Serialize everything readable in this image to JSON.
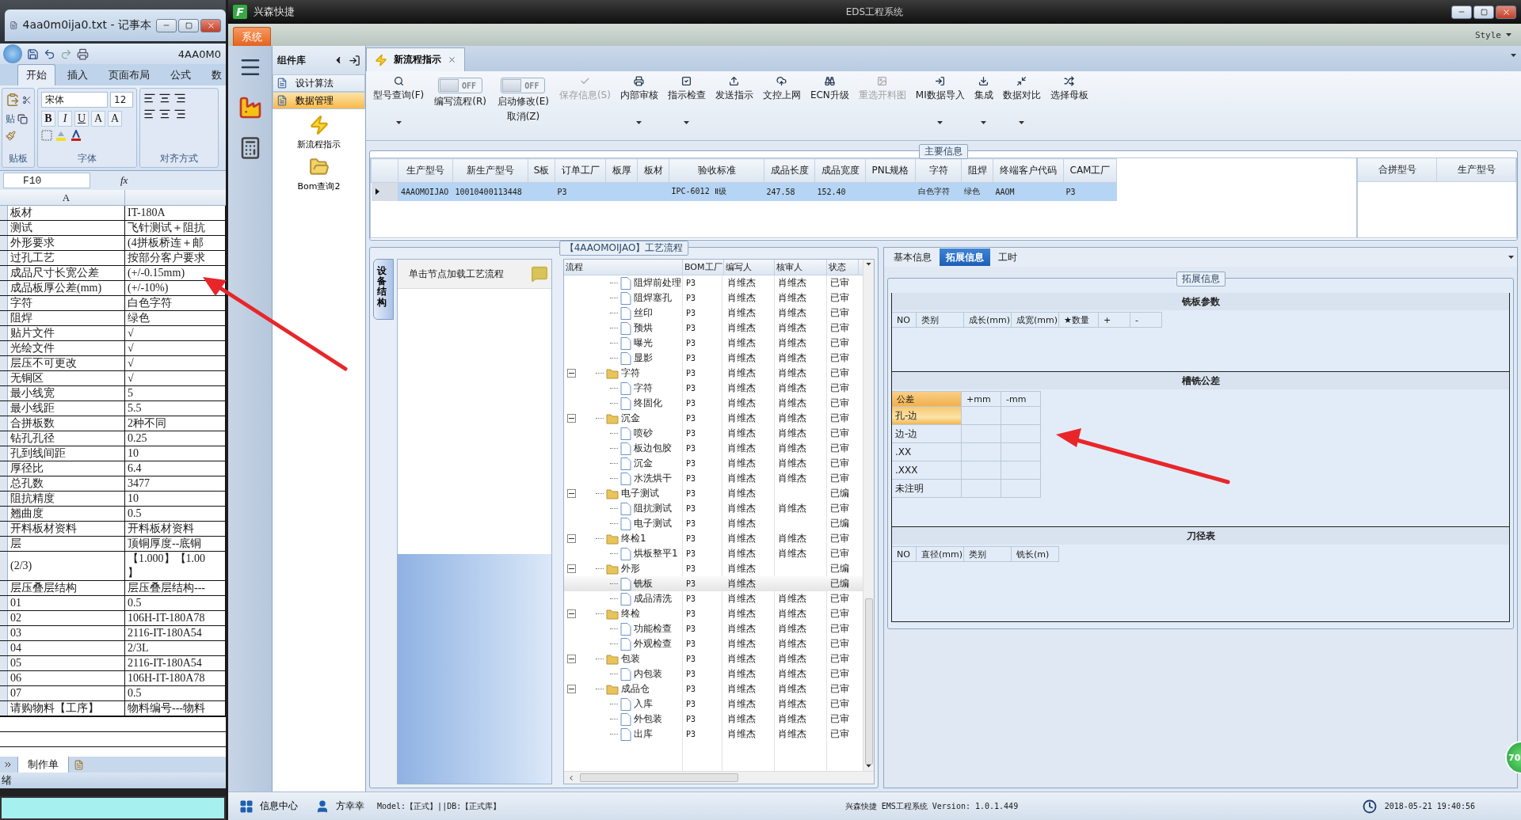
{
  "excel": {
    "notepad_title": "4aa0m0ija0.txt - 记事本",
    "book_title": "4AA0M0",
    "ribbon_tabs": [
      {
        "label": "开始",
        "selected": true
      },
      {
        "label": "插入",
        "selected": false
      },
      {
        "label": "页面布局",
        "selected": false
      },
      {
        "label": "公式",
        "selected": false
      },
      {
        "label": "数",
        "selected": false
      }
    ],
    "paste_label": "贴",
    "font_name": "宋体",
    "font_size": "12",
    "format_keys": [
      "B",
      "I",
      "U",
      "A",
      "A"
    ],
    "groups": [
      "贴板",
      "字体",
      "对齐方式"
    ],
    "name_box": "F10",
    "fx": "fx",
    "column_header": "A",
    "rows": [
      {
        "label": "板材",
        "value": "IT-180A"
      },
      {
        "label": "测试",
        "value": "飞针测试＋阻抗"
      },
      {
        "label": "外形要求",
        "value": "(4拼板桥连＋邮"
      },
      {
        "label": "过孔工艺",
        "value": "按部分客户要求"
      },
      {
        "label": "成品尺寸长宽公差",
        "value": "(+/-0.15mm)"
      },
      {
        "label": "成品板厚公差(mm)",
        "value": "(+/-10%)"
      },
      {
        "label": "字符",
        "value": "白色字符"
      },
      {
        "label": "阻焊",
        "value": "绿色"
      },
      {
        "label": "贴片文件",
        "value": "√"
      },
      {
        "label": "光绘文件",
        "value": "√"
      },
      {
        "label": "层压不可更改",
        "value": "√"
      },
      {
        "label": "无铜区",
        "value": "√"
      },
      {
        "label": "最小线宽",
        "value": "5"
      },
      {
        "label": "最小线距",
        "value": "5.5"
      },
      {
        "label": "合拼板数",
        "value": "2种不同"
      },
      {
        "label": "钻孔孔径",
        "value": "0.25"
      },
      {
        "label": "孔到线间距",
        "value": "10"
      },
      {
        "label": "厚径比",
        "value": "6.4"
      },
      {
        "label": "总孔数",
        "value": "3477"
      },
      {
        "label": "阻抗精度",
        "value": "10"
      },
      {
        "label": "翘曲度",
        "value": "0.5"
      },
      {
        "label": "开料板材资料",
        "value": "开料板材资料"
      },
      {
        "label": "层",
        "value": "顶铜厚度--底铜"
      },
      {
        "label": "(2/3)",
        "value": "【1.000】【1.00\n】"
      },
      {
        "label": "层压叠层结构",
        "value": "层压叠层结构---"
      },
      {
        "label": "01",
        "value": "0.5"
      },
      {
        "label": "02",
        "value": "106H-IT-180A78"
      },
      {
        "label": "03",
        "value": "2116-IT-180A54"
      },
      {
        "label": "04",
        "value": "2/3L"
      },
      {
        "label": "05",
        "value": "2116-IT-180A54"
      },
      {
        "label": "06",
        "value": "106H-IT-180A78"
      },
      {
        "label": "07",
        "value": "0.5"
      },
      {
        "label": "请购物料【工序】",
        "value": "物料编号---物料"
      }
    ],
    "sheet_tab": "制作单",
    "status": "绪"
  },
  "app": {
    "logo": "F",
    "title": "兴森快捷",
    "center_title": "EDS工程系统",
    "ribbon_tab": "系统",
    "style_menu": "Style"
  },
  "sidebar": {
    "title": "组件库",
    "categories": [
      {
        "label": "设计算法",
        "selected": false
      },
      {
        "label": "数据管理",
        "selected": true
      }
    ],
    "tools": [
      "新流程指示",
      "Bom查询2"
    ]
  },
  "doc_tabs": [
    {
      "label": "新流程指示",
      "selected": true
    }
  ],
  "toolbar": [
    {
      "kind": "button",
      "label": "型号查询(F)",
      "disabled": false,
      "dropdown": true
    },
    {
      "kind": "toggle",
      "label": "编写流程(R)",
      "switch_text": "OFF",
      "on": false
    },
    {
      "kind": "toggle",
      "label": "启动修改(E)",
      "sublabel": "取消(Z)",
      "switch_text": "OFF",
      "on": false
    },
    {
      "kind": "button",
      "label": "保存信息(S)",
      "disabled": true,
      "dropdown": false
    },
    {
      "kind": "button",
      "label": "内部审核",
      "disabled": false,
      "dropdown": true
    },
    {
      "kind": "button",
      "label": "指示检查",
      "disabled": false,
      "dropdown": true
    },
    {
      "kind": "button",
      "label": "发送指示",
      "disabled": false,
      "dropdown": false
    },
    {
      "kind": "button",
      "label": "文控上网",
      "disabled": false,
      "dropdown": false
    },
    {
      "kind": "button",
      "label": "ECN升级",
      "disabled": false,
      "dropdown": false
    },
    {
      "kind": "button",
      "label": "重选开料图",
      "disabled": true,
      "dropdown": false
    },
    {
      "kind": "button",
      "label": "MI数据导入",
      "disabled": false,
      "dropdown": true
    },
    {
      "kind": "button",
      "label": "集成",
      "disabled": false,
      "dropdown": true
    },
    {
      "kind": "button",
      "label": "数据对比",
      "disabled": false,
      "dropdown": true
    },
    {
      "kind": "button",
      "label": "选择母板",
      "disabled": false,
      "dropdown": false
    }
  ],
  "main_info": {
    "title": "主要信息",
    "columns": [
      "生产型号",
      "新生产型号",
      "S板",
      "订单工厂",
      "板厚",
      "板材",
      "验收标准",
      "成品长度",
      "成品宽度",
      "PNL规格",
      "字符",
      "阻焊",
      "终端客户代码",
      "CAM工厂"
    ],
    "rows": [
      {
        "selected": true,
        "cells": [
          "4AAOMOIJAO",
          "10010400113448",
          null,
          "P3",
          null,
          null,
          "IPC-6012 Ⅱ级",
          "247.58",
          "152.40",
          null,
          "白色字符",
          "绿色",
          "AAOM",
          "P3"
        ]
      }
    ],
    "side_columns": [
      "合拼型号",
      "生产型号"
    ]
  },
  "flow": {
    "title": "【4AAOMOIJAO】工艺流程",
    "side_tab": "设备结构",
    "hint": "单击节点加载工艺流程",
    "columns": [
      "流程",
      "BOM工厂",
      "编写人",
      "核审人",
      "状态"
    ],
    "continued": [
      {
        "label": "阻焊前处理",
        "bom": "P3",
        "writer": "肖维杰",
        "reviewer": "肖维杰",
        "status": "已审",
        "selected": false
      },
      {
        "label": "阻焊塞孔",
        "bom": "P3",
        "writer": "肖维杰",
        "reviewer": "肖维杰",
        "status": "已审",
        "selected": false
      },
      {
        "label": "丝印",
        "bom": "P3",
        "writer": "肖维杰",
        "reviewer": "肖维杰",
        "status": "已审",
        "selected": false
      },
      {
        "label": "预烘",
        "bom": "P3",
        "writer": "肖维杰",
        "reviewer": "肖维杰",
        "status": "已审",
        "selected": false
      },
      {
        "label": "曝光",
        "bom": "P3",
        "writer": "肖维杰",
        "reviewer": "肖维杰",
        "status": "已审",
        "selected": false
      },
      {
        "label": "显影",
        "bom": "P3",
        "writer": "肖维杰",
        "reviewer": "肖维杰",
        "status": "已审",
        "selected": false
      }
    ],
    "nodes": [
      {
        "label": "字符",
        "bom": "P3",
        "writer": "肖维杰",
        "reviewer": "肖维杰",
        "status": "已审",
        "selected": false,
        "expanded": true,
        "children": [
          {
            "label": "字符",
            "bom": "P3",
            "writer": "肖维杰",
            "reviewer": "肖维杰",
            "status": "已审",
            "selected": false
          },
          {
            "label": "终固化",
            "bom": "P3",
            "writer": "肖维杰",
            "reviewer": "肖维杰",
            "status": "已审",
            "selected": false
          }
        ]
      },
      {
        "label": "沉金",
        "bom": "P3",
        "writer": "肖维杰",
        "reviewer": "肖维杰",
        "status": "已审",
        "selected": false,
        "expanded": true,
        "children": [
          {
            "label": "喷砂",
            "bom": "P3",
            "writer": "肖维杰",
            "reviewer": "肖维杰",
            "status": "已审",
            "selected": false
          },
          {
            "label": "板边包胶",
            "bom": "P3",
            "writer": "肖维杰",
            "reviewer": "肖维杰",
            "status": "已审",
            "selected": false
          },
          {
            "label": "沉金",
            "bom": "P3",
            "writer": "肖维杰",
            "reviewer": "肖维杰",
            "status": "已审",
            "selected": false
          },
          {
            "label": "水洗烘干",
            "bom": "P3",
            "writer": "肖维杰",
            "reviewer": "肖维杰",
            "status": "已审",
            "selected": false
          }
        ]
      },
      {
        "label": "电子测试",
        "bom": "P3",
        "writer": "肖维杰",
        "status": "已编",
        "selected": false,
        "expanded": true,
        "children": [
          {
            "label": "阻抗测试",
            "bom": "P3",
            "writer": "肖维杰",
            "reviewer": "肖维杰",
            "status": "已审",
            "selected": false
          },
          {
            "label": "电子测试",
            "bom": "P3",
            "writer": "肖维杰",
            "status": "已编",
            "selected": false
          }
        ]
      },
      {
        "label": "终检1",
        "bom": "P3",
        "writer": "肖维杰",
        "reviewer": "肖维杰",
        "status": "已审",
        "selected": false,
        "expanded": true,
        "children": [
          {
            "label": "烘板整平1",
            "bom": "P3",
            "writer": "肖维杰",
            "reviewer": "肖维杰",
            "status": "已审",
            "selected": false
          }
        ]
      },
      {
        "label": "外形",
        "bom": "P3",
        "writer": "肖维杰",
        "status": "已编",
        "selected": false,
        "expanded": true,
        "children": [
          {
            "label": "铣板",
            "bom": "P3",
            "writer": "肖维杰",
            "status": "已编",
            "selected": true
          },
          {
            "label": "成品清洗",
            "bom": "P3",
            "writer": "肖维杰",
            "reviewer": "肖维杰",
            "status": "已审",
            "selected": false
          }
        ]
      },
      {
        "label": "终检",
        "bom": "P3",
        "writer": "肖维杰",
        "reviewer": "肖维杰",
        "status": "已审",
        "selected": false,
        "expanded": true,
        "children": [
          {
            "label": "功能检查",
            "bom": "P3",
            "writer": "肖维杰",
            "reviewer": "肖维杰",
            "status": "已审",
            "selected": false
          },
          {
            "label": "外观检查",
            "bom": "P3",
            "writer": "肖维杰",
            "reviewer": "肖维杰",
            "status": "已审",
            "selected": false
          }
        ]
      },
      {
        "label": "包装",
        "bom": "P3",
        "writer": "肖维杰",
        "reviewer": "肖维杰",
        "status": "已审",
        "selected": false,
        "expanded": true,
        "children": [
          {
            "label": "内包装",
            "bom": "P3",
            "writer": "肖维杰",
            "reviewer": "肖维杰",
            "status": "已审",
            "selected": false
          }
        ]
      },
      {
        "label": "成品仓",
        "bom": "P3",
        "writer": "肖维杰",
        "reviewer": "肖维杰",
        "status": "已审",
        "selected": false,
        "expanded": true,
        "children": [
          {
            "label": "入库",
            "bom": "P3",
            "writer": "肖维杰",
            "reviewer": "肖维杰",
            "status": "已审",
            "selected": false
          },
          {
            "label": "外包装",
            "bom": "P3",
            "writer": "肖维杰",
            "reviewer": "肖维杰",
            "status": "已审",
            "selected": false
          },
          {
            "label": "出库",
            "bom": "P3",
            "writer": "肖维杰",
            "reviewer": "肖维杰",
            "status": "已审",
            "selected": false
          }
        ]
      }
    ]
  },
  "detail": {
    "tabs": [
      {
        "label": "基本信息",
        "selected": false
      },
      {
        "label": "拓展信息",
        "selected": true
      },
      {
        "label": "工时",
        "selected": false
      }
    ],
    "title": "拓展信息",
    "sections": [
      {
        "kind": "grid",
        "title": "铣板参数",
        "columns": [
          "NO",
          "类别",
          "成长(mm)",
          "成宽(mm)",
          "★数量",
          "+",
          "-"
        ]
      },
      {
        "kind": "tolerance",
        "title": "槽铣公差",
        "columns": [
          "公差",
          "+mm",
          "-mm"
        ],
        "rows": [
          {
            "label": "孔-边",
            "selected": true
          },
          {
            "label": "边-边",
            "selected": false
          },
          {
            "label": ".XX",
            "selected": false
          },
          {
            "label": ".XXX",
            "selected": false
          },
          {
            "label": "未注明",
            "selected": false
          }
        ]
      },
      {
        "kind": "grid",
        "title": "刀径表",
        "columns": [
          "NO",
          "直径(mm)",
          "类别",
          "铣长(m)"
        ]
      }
    ]
  },
  "status_bar": {
    "items": [
      "信息中心",
      "方幸幸"
    ],
    "model": "Model:【正式】||DB:【正式库】",
    "version": "兴森快捷  EMS工程系统  Version: 1.0.1.449",
    "time": "2018-05-21  19:40:56"
  },
  "badge": "70"
}
